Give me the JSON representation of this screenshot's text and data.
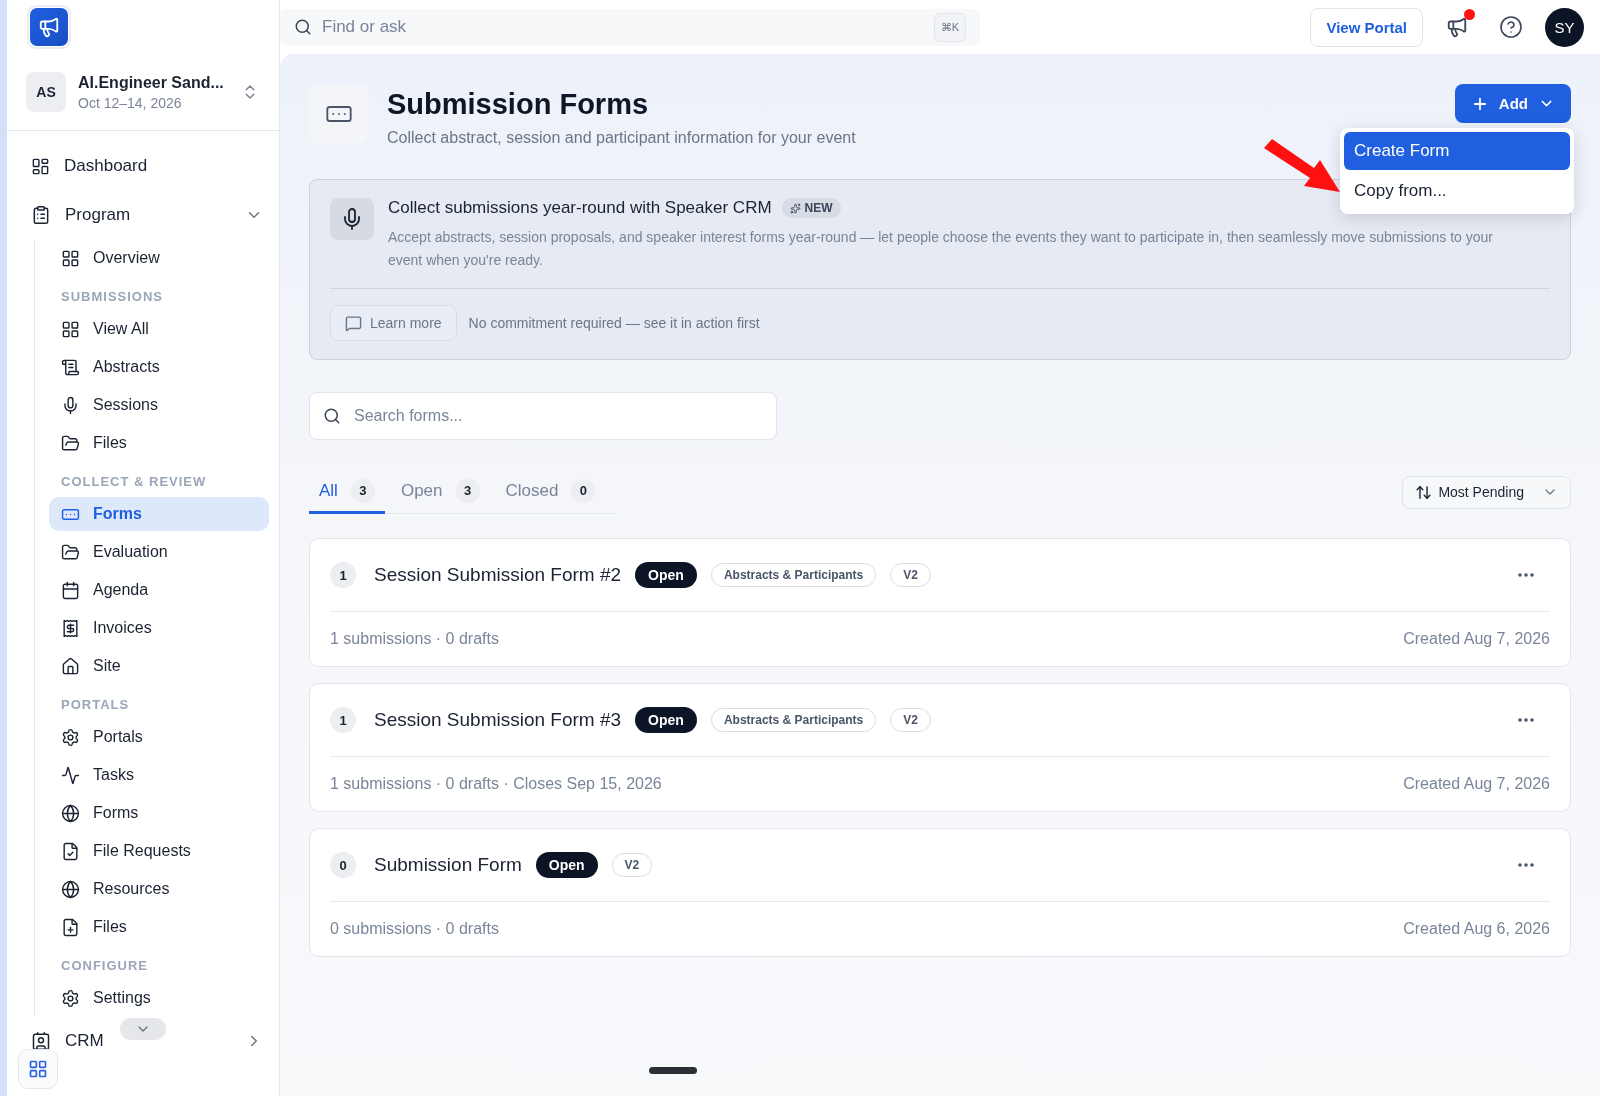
{
  "event": {
    "initials": "AS",
    "name": "AI.Engineer Sand...",
    "dates": "Oct 12–14, 2026"
  },
  "nav": [
    {
      "kind": "link",
      "label": "Dashboard",
      "selected": false
    },
    {
      "kind": "group",
      "label": "Program",
      "expanded": true,
      "children": [
        {
          "kind": "link",
          "label": "Overview",
          "selected": false
        },
        {
          "kind": "heading",
          "label": "SUBMISSIONS"
        },
        {
          "kind": "link",
          "label": "View All",
          "selected": false
        },
        {
          "kind": "link",
          "label": "Abstracts",
          "selected": false
        },
        {
          "kind": "link",
          "label": "Sessions",
          "selected": false
        },
        {
          "kind": "link",
          "label": "Files",
          "selected": false
        },
        {
          "kind": "heading",
          "label": "COLLECT & REVIEW"
        },
        {
          "kind": "link",
          "label": "Forms",
          "selected": true
        },
        {
          "kind": "link",
          "label": "Evaluation",
          "selected": false
        },
        {
          "kind": "link",
          "label": "Agenda",
          "selected": false
        },
        {
          "kind": "link",
          "label": "Invoices",
          "selected": false
        },
        {
          "kind": "link",
          "label": "Site",
          "selected": false
        },
        {
          "kind": "heading",
          "label": "PORTALS"
        },
        {
          "kind": "link",
          "label": "Portals",
          "selected": false
        },
        {
          "kind": "link",
          "label": "Tasks",
          "selected": false
        },
        {
          "kind": "link",
          "label": "Forms",
          "selected": false
        },
        {
          "kind": "link",
          "label": "File Requests",
          "selected": false
        },
        {
          "kind": "link",
          "label": "Resources",
          "selected": false
        },
        {
          "kind": "link",
          "label": "Files",
          "selected": false
        },
        {
          "kind": "heading",
          "label": "CONFIGURE"
        },
        {
          "kind": "link",
          "label": "Settings",
          "selected": false
        }
      ]
    },
    {
      "kind": "group",
      "label": "CRM",
      "expanded": false
    }
  ],
  "topbar": {
    "search": {
      "placeholder": "Find or ask",
      "shortcut": "⌘K"
    },
    "view_portal": "View Portal",
    "notification": true,
    "avatar": "SY"
  },
  "header": {
    "title": "Submission Forms",
    "subtitle": "Collect abstract, session and participant information for your event",
    "add_button": "Add",
    "menu": [
      {
        "label": "Create Form",
        "selected": true
      },
      {
        "label": "Copy from...",
        "selected": false
      }
    ]
  },
  "banner": {
    "title": "Collect submissions year-round with Speaker CRM",
    "badge": "NEW",
    "text": "Accept abstracts, session proposals, and speaker interest forms year-round — let people choose the events they want to participate in, then seamlessly move submissions to your event when you're ready.",
    "learn_more": "Learn more",
    "note": "No commitment required — see it in action first"
  },
  "search": {
    "placeholder": "Search forms..."
  },
  "tabs": [
    {
      "label": "All",
      "count": "3",
      "selected": true
    },
    {
      "label": "Open",
      "count": "3",
      "selected": false
    },
    {
      "label": "Closed",
      "count": "0",
      "selected": false
    }
  ],
  "sort": {
    "label": "Most Pending"
  },
  "forms": [
    {
      "count": "1",
      "name": "Session Submission Form #2",
      "status": "Open",
      "tags": [
        "Abstracts & Participants",
        "V2"
      ],
      "meta": "1 submissions · 0 drafts",
      "created": "Created Aug 7, 2026"
    },
    {
      "count": "1",
      "name": "Session Submission Form #3",
      "status": "Open",
      "tags": [
        "Abstracts & Participants",
        "V2"
      ],
      "meta": "1 submissions · 0 drafts · Closes Sep 15, 2026",
      "created": "Created Aug 7, 2026"
    },
    {
      "count": "0",
      "name": "Submission Form",
      "status": "Open",
      "tags": [
        "V2"
      ],
      "meta": "0 submissions · 0 drafts",
      "created": "Created Aug 6, 2026"
    }
  ]
}
